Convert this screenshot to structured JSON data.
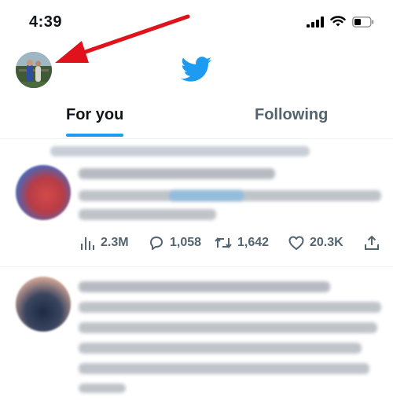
{
  "status_bar": {
    "time": "4:39"
  },
  "header": {
    "logo": "twitter-bird-icon"
  },
  "tabs": [
    {
      "label": "For you",
      "active": true
    },
    {
      "label": "Following",
      "active": false
    }
  ],
  "tweets": [
    {
      "content": "blurred",
      "actions": {
        "views": "2.3M",
        "replies": "1,058",
        "retweets": "1,642",
        "likes": "20.3K"
      }
    },
    {
      "content": "blurred"
    }
  ],
  "colors": {
    "accent": "#1d9bf0",
    "annotation_arrow": "#e0121b",
    "text_primary": "#0f1419",
    "text_secondary": "#536471"
  }
}
